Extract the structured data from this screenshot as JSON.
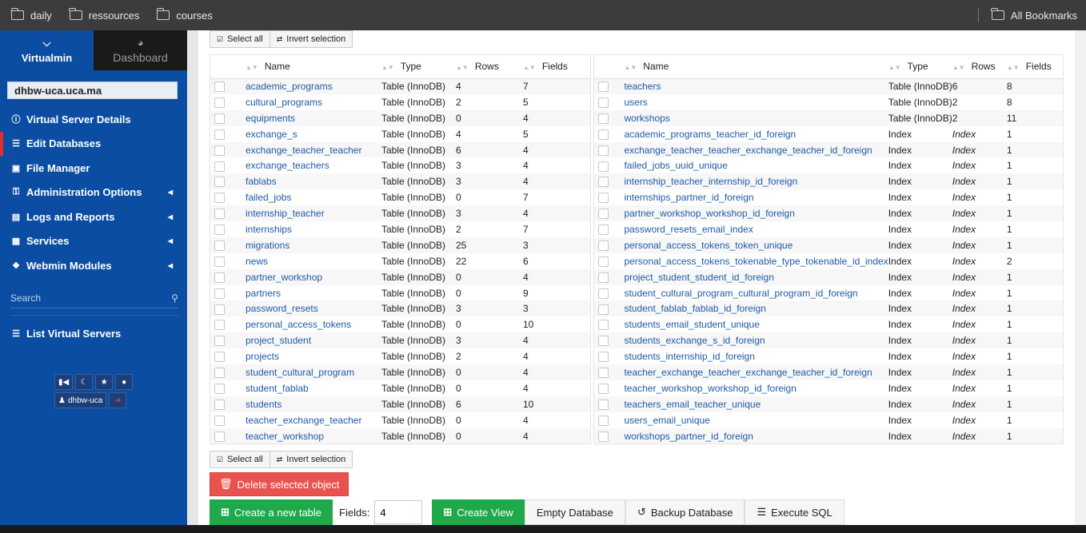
{
  "bookmarks": {
    "items": [
      {
        "label": "daily"
      },
      {
        "label": "ressources"
      },
      {
        "label": "courses"
      }
    ],
    "all_label": "All Bookmarks"
  },
  "sidebar": {
    "tab_active": "Virtualmin",
    "tab_inactive": "Dashboard",
    "domain": "dhbw-uca.uca.ma",
    "menu": [
      {
        "label": "Virtual Server Details",
        "icon": "info-icon"
      },
      {
        "label": "Edit Databases",
        "icon": "database-icon"
      },
      {
        "label": "File Manager",
        "icon": "folder-icon"
      },
      {
        "label": "Administration Options",
        "icon": "key-icon"
      },
      {
        "label": "Logs and Reports",
        "icon": "file-icon"
      },
      {
        "label": "Services",
        "icon": "sitemap-icon"
      },
      {
        "label": "Webmin Modules",
        "icon": "cubes-icon"
      }
    ],
    "search_placeholder": "Search",
    "list_servers": "List Virtual Servers",
    "user": "dhbw-uca"
  },
  "toolbar": {
    "select_all": "Select all",
    "invert_selection": "Invert selection"
  },
  "headers": {
    "name": "Name",
    "type": "Type",
    "rows": "Rows",
    "fields": "Fields"
  },
  "left_rows": [
    {
      "name": "academic_programs",
      "type": "Table (InnoDB)",
      "rows": "4",
      "fields": "7"
    },
    {
      "name": "cultural_programs",
      "type": "Table (InnoDB)",
      "rows": "2",
      "fields": "5"
    },
    {
      "name": "equipments",
      "type": "Table (InnoDB)",
      "rows": "0",
      "fields": "4"
    },
    {
      "name": "exchange_s",
      "type": "Table (InnoDB)",
      "rows": "4",
      "fields": "5"
    },
    {
      "name": "exchange_teacher_teacher",
      "type": "Table (InnoDB)",
      "rows": "6",
      "fields": "4"
    },
    {
      "name": "exchange_teachers",
      "type": "Table (InnoDB)",
      "rows": "3",
      "fields": "4"
    },
    {
      "name": "fablabs",
      "type": "Table (InnoDB)",
      "rows": "3",
      "fields": "4"
    },
    {
      "name": "failed_jobs",
      "type": "Table (InnoDB)",
      "rows": "0",
      "fields": "7"
    },
    {
      "name": "internship_teacher",
      "type": "Table (InnoDB)",
      "rows": "3",
      "fields": "4"
    },
    {
      "name": "internships",
      "type": "Table (InnoDB)",
      "rows": "2",
      "fields": "7"
    },
    {
      "name": "migrations",
      "type": "Table (InnoDB)",
      "rows": "25",
      "fields": "3"
    },
    {
      "name": "news",
      "type": "Table (InnoDB)",
      "rows": "22",
      "fields": "6"
    },
    {
      "name": "partner_workshop",
      "type": "Table (InnoDB)",
      "rows": "0",
      "fields": "4"
    },
    {
      "name": "partners",
      "type": "Table (InnoDB)",
      "rows": "0",
      "fields": "9"
    },
    {
      "name": "password_resets",
      "type": "Table (InnoDB)",
      "rows": "3",
      "fields": "3"
    },
    {
      "name": "personal_access_tokens",
      "type": "Table (InnoDB)",
      "rows": "0",
      "fields": "10"
    },
    {
      "name": "project_student",
      "type": "Table (InnoDB)",
      "rows": "3",
      "fields": "4"
    },
    {
      "name": "projects",
      "type": "Table (InnoDB)",
      "rows": "2",
      "fields": "4"
    },
    {
      "name": "student_cultural_program",
      "type": "Table (InnoDB)",
      "rows": "0",
      "fields": "4"
    },
    {
      "name": "student_fablab",
      "type": "Table (InnoDB)",
      "rows": "0",
      "fields": "4"
    },
    {
      "name": "students",
      "type": "Table (InnoDB)",
      "rows": "6",
      "fields": "10"
    },
    {
      "name": "teacher_exchange_teacher",
      "type": "Table (InnoDB)",
      "rows": "0",
      "fields": "4"
    },
    {
      "name": "teacher_workshop",
      "type": "Table (InnoDB)",
      "rows": "0",
      "fields": "4"
    }
  ],
  "right_rows": [
    {
      "name": "teachers",
      "type": "Table (InnoDB)",
      "rows": "6",
      "fields": "8"
    },
    {
      "name": "users",
      "type": "Table (InnoDB)",
      "rows": "2",
      "fields": "8"
    },
    {
      "name": "workshops",
      "type": "Table (InnoDB)",
      "rows": "2",
      "fields": "11"
    },
    {
      "name": "academic_programs_teacher_id_foreign",
      "type": "Index",
      "rows": "Index",
      "fields": "1"
    },
    {
      "name": "exchange_teacher_teacher_exchange_teacher_id_foreign",
      "type": "Index",
      "rows": "Index",
      "fields": "1"
    },
    {
      "name": "failed_jobs_uuid_unique",
      "type": "Index",
      "rows": "Index",
      "fields": "1"
    },
    {
      "name": "internship_teacher_internship_id_foreign",
      "type": "Index",
      "rows": "Index",
      "fields": "1"
    },
    {
      "name": "internships_partner_id_foreign",
      "type": "Index",
      "rows": "Index",
      "fields": "1"
    },
    {
      "name": "partner_workshop_workshop_id_foreign",
      "type": "Index",
      "rows": "Index",
      "fields": "1"
    },
    {
      "name": "password_resets_email_index",
      "type": "Index",
      "rows": "Index",
      "fields": "1"
    },
    {
      "name": "personal_access_tokens_token_unique",
      "type": "Index",
      "rows": "Index",
      "fields": "1"
    },
    {
      "name": "personal_access_tokens_tokenable_type_tokenable_id_index",
      "type": "Index",
      "rows": "Index",
      "fields": "2"
    },
    {
      "name": "project_student_student_id_foreign",
      "type": "Index",
      "rows": "Index",
      "fields": "1"
    },
    {
      "name": "student_cultural_program_cultural_program_id_foreign",
      "type": "Index",
      "rows": "Index",
      "fields": "1"
    },
    {
      "name": "student_fablab_fablab_id_foreign",
      "type": "Index",
      "rows": "Index",
      "fields": "1"
    },
    {
      "name": "students_email_student_unique",
      "type": "Index",
      "rows": "Index",
      "fields": "1"
    },
    {
      "name": "students_exchange_s_id_foreign",
      "type": "Index",
      "rows": "Index",
      "fields": "1"
    },
    {
      "name": "students_internship_id_foreign",
      "type": "Index",
      "rows": "Index",
      "fields": "1"
    },
    {
      "name": "teacher_exchange_teacher_exchange_teacher_id_foreign",
      "type": "Index",
      "rows": "Index",
      "fields": "1"
    },
    {
      "name": "teacher_workshop_workshop_id_foreign",
      "type": "Index",
      "rows": "Index",
      "fields": "1"
    },
    {
      "name": "teachers_email_teacher_unique",
      "type": "Index",
      "rows": "Index",
      "fields": "1"
    },
    {
      "name": "users_email_unique",
      "type": "Index",
      "rows": "Index",
      "fields": "1"
    },
    {
      "name": "workshops_partner_id_foreign",
      "type": "Index",
      "rows": "Index",
      "fields": "1"
    }
  ],
  "actions": {
    "delete": "Delete selected object",
    "create_table": "Create a new table",
    "fields_label": "Fields:",
    "fields_value": "4",
    "create_view": "Create View",
    "empty_db": "Empty Database",
    "backup_db": "Backup Database",
    "execute_sql": "Execute SQL"
  }
}
